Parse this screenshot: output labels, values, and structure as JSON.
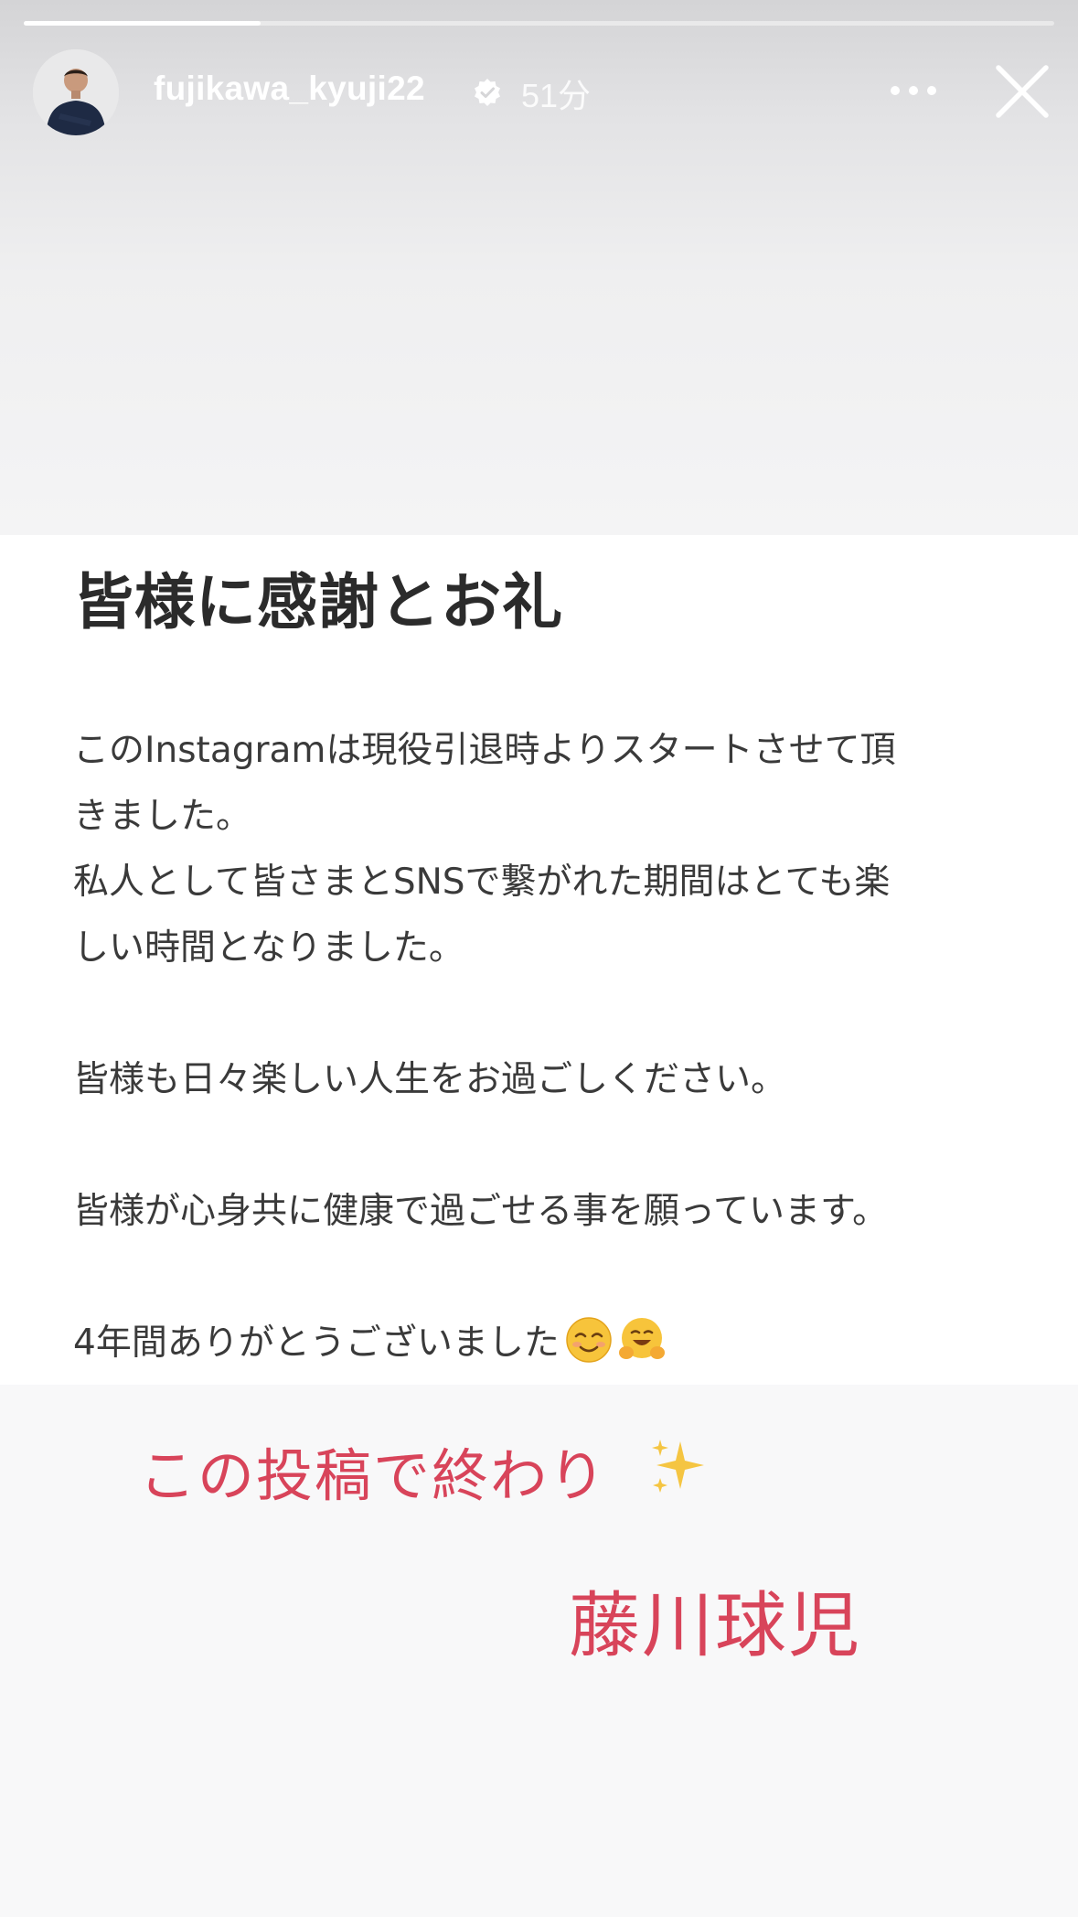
{
  "story": {
    "progress": 0.23,
    "username": "fujikawa_kyuji22",
    "verified": true,
    "time_ago": "51分",
    "icons": {
      "avatar": "profile-photo",
      "verified": "verified-badge-icon",
      "more": "more-horizontal-icon",
      "close": "close-icon"
    }
  },
  "post": {
    "title": "皆様に感謝とお礼",
    "paragraph1_line1": "このInstagramは現役引退時よりスタートさせて頂",
    "paragraph1_line2": "きました。",
    "paragraph1_line3": "私人として皆さまとSNSで繋がれた期間はとても楽",
    "paragraph1_line4": "しい時間となりました。",
    "paragraph2": "皆様も日々楽しい人生をお過ごしください。",
    "paragraph3": "皆様が心身共に健康で過ごせる事を願っています。",
    "paragraph4": "4年間ありがとうございました",
    "emojis": [
      "smiling-face-icon",
      "hugging-face-icon"
    ]
  },
  "sticker": {
    "line1": "この投稿で終わり",
    "line2": "藤川球児",
    "color": "#d8445a",
    "icon": "sparkles-icon"
  }
}
